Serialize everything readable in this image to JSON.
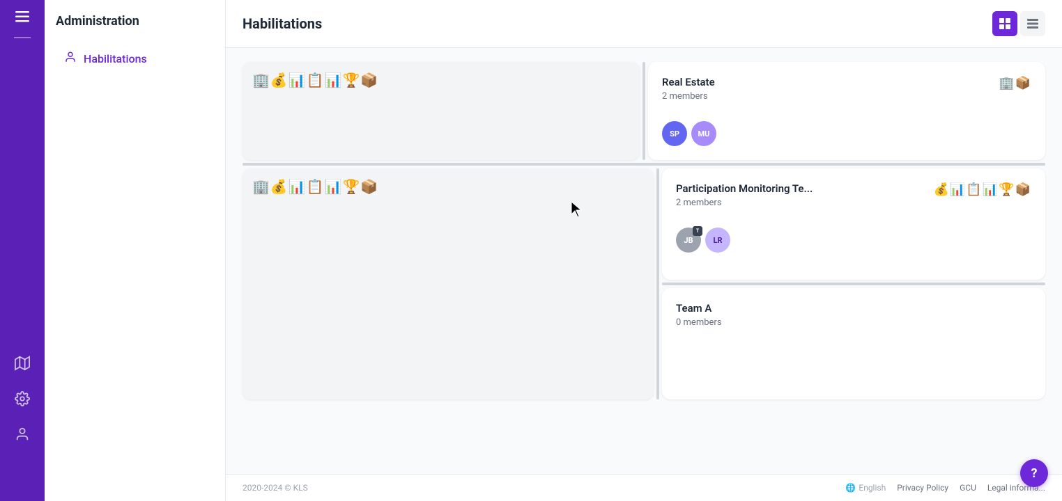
{
  "sidebar": {
    "menu_icon": "☰",
    "items": [
      {
        "name": "map",
        "icon": "🗺",
        "label": "Map"
      },
      {
        "name": "settings",
        "icon": "⚙",
        "label": "Settings"
      },
      {
        "name": "user",
        "icon": "👤",
        "label": "User"
      }
    ]
  },
  "left_panel": {
    "title": "Administration",
    "nav": [
      {
        "name": "habilitations",
        "label": "Habilitations",
        "active": true
      }
    ]
  },
  "main": {
    "title": "Habilitations",
    "view_grid_label": "Grid view",
    "view_list_label": "List view",
    "cards": [
      {
        "id": "card-top-left",
        "title": "",
        "members_count": "",
        "members_label": "",
        "emojis": "🏢💰📊📋📊🏆📦",
        "avatars": [],
        "empty": true
      },
      {
        "id": "card-real-estate",
        "title": "Real Estate",
        "members_count": "2",
        "members_label": "2 members",
        "emojis": "🏢📦",
        "avatars": [
          {
            "initials": "SP",
            "class": "sp"
          },
          {
            "initials": "MU",
            "class": "mu"
          }
        ],
        "empty": false
      },
      {
        "id": "card-mid-left",
        "title": "",
        "members_count": "",
        "members_label": "",
        "emojis": "🏢💰📊📋📊🏆📦",
        "avatars": [],
        "empty": true
      },
      {
        "id": "card-participation",
        "title": "Participation Monitoring Te...",
        "members_count": "2",
        "members_label": "2 members",
        "emojis": "💰📊📋📊🏆📦",
        "avatars": [
          {
            "initials": "JB",
            "class": "jb",
            "badge": true
          },
          {
            "initials": "LR",
            "class": "lr"
          }
        ],
        "empty": false
      },
      {
        "id": "card-team-a",
        "title": "Team A",
        "members_count": "0",
        "members_label": "0 members",
        "emojis": "",
        "avatars": [],
        "empty": false
      }
    ]
  },
  "footer": {
    "copyright": "2020-2024 © KLS",
    "language_icon": "🌐",
    "language": "English",
    "links": [
      "Privacy Policy",
      "GCU",
      "Legal informa..."
    ]
  },
  "help": {
    "label": "?"
  }
}
